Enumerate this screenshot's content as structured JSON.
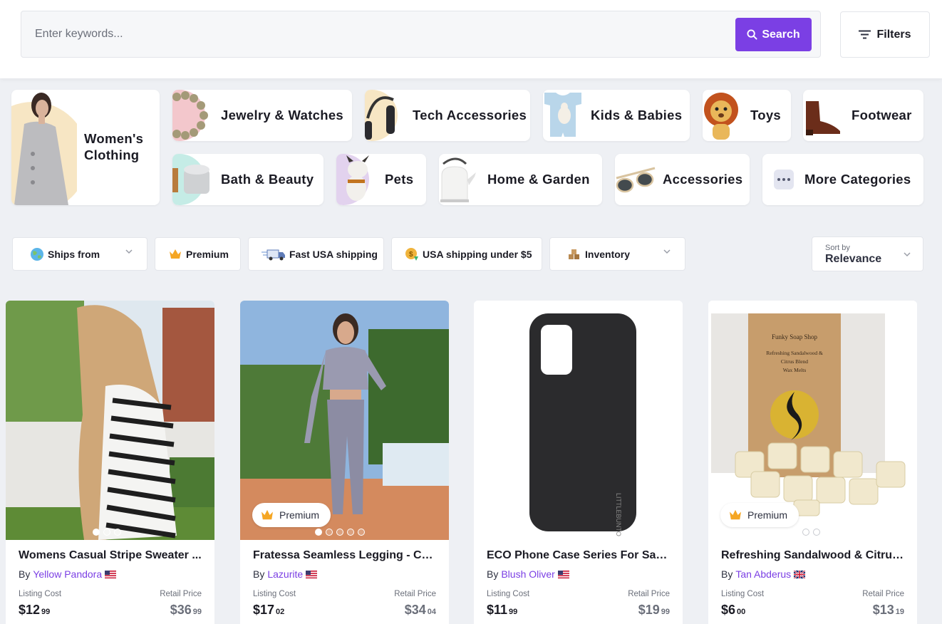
{
  "search": {
    "placeholder": "Enter keywords...",
    "button_label": "Search"
  },
  "filters_label": "Filters",
  "categories": [
    {
      "label": "Women's\nClothing",
      "icon": "womens-clothing-photo"
    },
    {
      "label": "Jewelry & Watches",
      "icon": "bracelet-photo"
    },
    {
      "label": "Tech Accessories",
      "icon": "headphones-photo"
    },
    {
      "label": "Kids & Babies",
      "icon": "baby-onesie-photo"
    },
    {
      "label": "Toys",
      "icon": "lion-plush-photo"
    },
    {
      "label": "Footwear",
      "icon": "boot-photo"
    },
    {
      "label": "Bath & Beauty",
      "icon": "candle-tin-photo"
    },
    {
      "label": "Pets",
      "icon": "bulldog-photo"
    },
    {
      "label": "Home & Garden",
      "icon": "kettle-photo"
    },
    {
      "label": "Accessories",
      "icon": "sunglasses-photo"
    },
    {
      "label": "More Categories",
      "icon": "more-dots-icon"
    }
  ],
  "chips": [
    {
      "label": "Ships from",
      "icon": "globe-icon"
    },
    {
      "label": "Premium",
      "icon": "crown-icon"
    },
    {
      "label": "Fast USA shipping",
      "icon": "truck-icon"
    },
    {
      "label": "USA shipping under $5",
      "icon": "coin-icon"
    },
    {
      "label": "Inventory",
      "icon": "boxes-icon"
    }
  ],
  "sort": {
    "label": "Sort by",
    "value": "Relevance"
  },
  "products": [
    {
      "title": "Womens Casual Stripe Sweater ...",
      "by": "By",
      "vendor": "Yellow Pandora",
      "flag": "US",
      "listing_label": "Listing Cost",
      "retail_label": "Retail Price",
      "listing_dollars": "$12",
      "listing_cents": "99",
      "retail_dollars": "$36",
      "retail_cents": "99",
      "premium": false,
      "dots_total": 3,
      "dots_active": 1
    },
    {
      "title": "Fratessa Seamless Legging - Cha...",
      "by": "By",
      "vendor": "Lazurite",
      "flag": "US",
      "listing_label": "Listing Cost",
      "retail_label": "Retail Price",
      "listing_dollars": "$17",
      "listing_cents": "02",
      "retail_dollars": "$34",
      "retail_cents": "04",
      "premium": true,
      "premium_label": "Premium",
      "dots_total": 5,
      "dots_active": 1
    },
    {
      "title": "ECO Phone Case Series For Sam...",
      "by": "By",
      "vendor": "Blush Oliver",
      "flag": "US",
      "listing_label": "Listing Cost",
      "retail_label": "Retail Price",
      "listing_dollars": "$11",
      "listing_cents": "99",
      "retail_dollars": "$19",
      "retail_cents": "99",
      "premium": false,
      "dots_total": 0,
      "dots_active": 0,
      "phone_brand": "LITTLEBUNTO"
    },
    {
      "title": "Refreshing Sandalwood & Citrus...",
      "by": "By",
      "vendor": "Tan Abderus",
      "flag": "UK",
      "listing_label": "Listing Cost",
      "retail_label": "Retail Price",
      "listing_dollars": "$6",
      "listing_cents": "00",
      "retail_dollars": "$13",
      "retail_cents": "19",
      "premium": true,
      "premium_label": "Premium",
      "dots_total": 2,
      "dots_active": 1,
      "box_text": [
        "Funky Soap Shop",
        "Refreshing Sandalwood &",
        "Citrus Blend",
        "Wax Melts"
      ]
    }
  ],
  "colors": {
    "accent": "#7b3fe4",
    "background": "#eef0f4"
  }
}
